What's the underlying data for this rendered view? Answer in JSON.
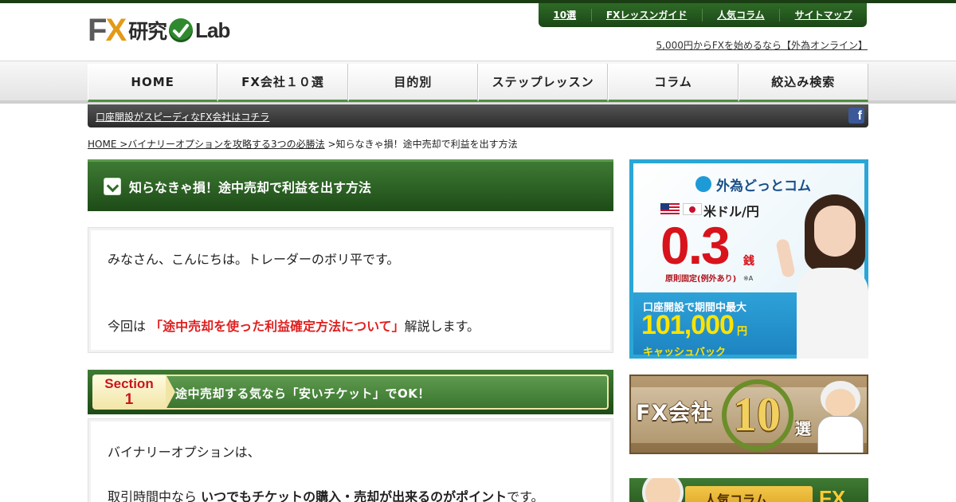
{
  "logo": {
    "fx_f": "F",
    "fx_x": "X",
    "kanji": "研究",
    "lab": "Lab"
  },
  "topnav": [
    "10選",
    "FXレッスンガイド",
    "人気コラム",
    "サイトマップ"
  ],
  "toplink": "5,000円からFXを始めるなら【外為オンライン】",
  "mainnav": [
    "HOME",
    "FX会社１０選",
    "目的別",
    "ステップレッスン",
    "コラム",
    "絞込み検索"
  ],
  "subbar": {
    "link": "口座開設がスピーディなFX会社はコチラ",
    "social_icon": "facebook-icon"
  },
  "breadcrumb": {
    "home": "HOME",
    "sep1": " >",
    "parent": "バイナリーオプションを攻略する3つの必勝法",
    "sep2": " >",
    "current": "知らなきゃ損！途中売却で利益を出す方法"
  },
  "article": {
    "title": "知らなきゃ損！途中売却で利益を出す方法",
    "intro": "みなさん、こんにちは。トレーダーのボリ平です。",
    "lead_pre": "今回は",
    "lead_highlight": "「途中売却を使った利益確定方法について」",
    "lead_post": "解説します。",
    "section1": {
      "badge_word": "Section",
      "badge_num": "1",
      "title": "途中売却する気なら「安いチケット」でOK！",
      "p1": "バイナリーオプションは、",
      "p2_pre": "取引時間中なら ",
      "p2_bold": "いつでもチケットの購入・売却が出来るのがポイント",
      "p2_post": "です。"
    }
  },
  "ads": {
    "gaitame": {
      "brand": "外為どっとコム",
      "pair": "米ドル/円",
      "spread": "0.3",
      "spread_unit": "銭",
      "note": "原則固定(例外あり)",
      "note_mark": "※A",
      "campaign": "口座開設で期間中最大",
      "amount": "101,000",
      "amount_unit": "円",
      "cashback": "キャッシュバック"
    },
    "top10": {
      "fx": "FX会社",
      "num": "10",
      "sen": "選"
    },
    "column": {
      "label": "人気コラム",
      "fx": "FX"
    }
  },
  "colors": {
    "header_green": "#1b4617",
    "accent_red": "#e02020",
    "ad_blue": "#2ba6d6"
  }
}
